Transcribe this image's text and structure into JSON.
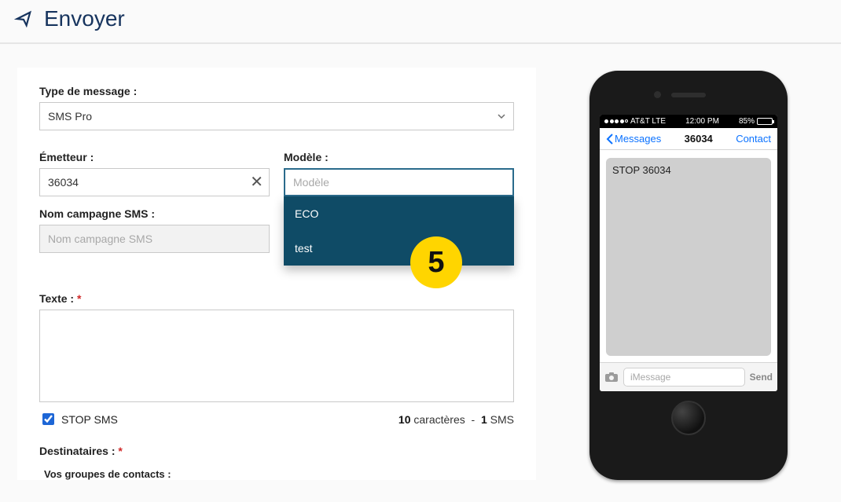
{
  "header": {
    "title": "Envoyer"
  },
  "step_badge": "5",
  "form": {
    "message_type": {
      "label": "Type de message :",
      "value": "SMS Pro"
    },
    "emitter": {
      "label": "Émetteur :",
      "value": "36034"
    },
    "model": {
      "label": "Modèle :",
      "placeholder": "Modèle",
      "options": [
        "ECO",
        "test"
      ]
    },
    "campaign": {
      "label": "Nom campagne SMS :",
      "placeholder": "Nom campagne SMS"
    },
    "text": {
      "label": "Texte :"
    },
    "stop_sms": {
      "label": "STOP SMS",
      "checked": true
    },
    "counter": {
      "chars": "10",
      "chars_label": "caractères",
      "sep": "-",
      "sms": "1",
      "sms_label": "SMS"
    },
    "recipients": {
      "label": "Destinataires :"
    },
    "groups": {
      "label": "Vos groupes de contacts :"
    }
  },
  "phone": {
    "carrier": "AT&T LTE",
    "time": "12:00 PM",
    "battery_pct": "85%",
    "back_label": "Messages",
    "title": "36034",
    "contact": "Contact",
    "bubble": "STOP 36034",
    "compose_placeholder": "iMessage",
    "send_label": "Send"
  }
}
